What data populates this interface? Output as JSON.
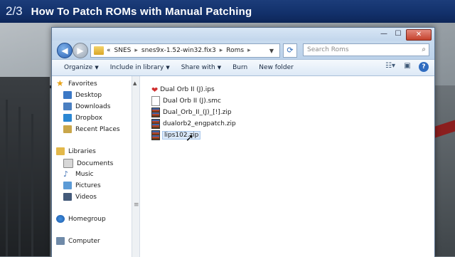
{
  "banner": {
    "step": "2/3",
    "title": "How To Patch ROMs with Manual Patching"
  },
  "window_controls": {
    "minimize": "—",
    "maximize": "☐",
    "close": "✕"
  },
  "address": {
    "root": "«",
    "crumbs": [
      "SNES",
      "snes9x-1.52-win32.fix3",
      "Roms"
    ],
    "separator": "▸",
    "search_placeholder": "Search Roms"
  },
  "toolbar": {
    "organize": "Organize",
    "include": "Include in library",
    "share": "Share with",
    "burn": "Burn",
    "new_folder": "New folder"
  },
  "nav": {
    "favorites": "Favorites",
    "desktop": "Desktop",
    "downloads": "Downloads",
    "dropbox": "Dropbox",
    "recent": "Recent Places",
    "libraries": "Libraries",
    "documents": "Documents",
    "music": "Music",
    "pictures": "Pictures",
    "videos": "Videos",
    "homegroup": "Homegroup",
    "computer": "Computer"
  },
  "files": [
    {
      "name": "Dual Orb II (J).ips",
      "icon": "heart-icon"
    },
    {
      "name": "Dual Orb II (J).smc",
      "icon": "document-icon"
    },
    {
      "name": "Dual_Orb_II_(J)_[!].zip",
      "icon": "zip-icon"
    },
    {
      "name": "dualorb2_engpatch.zip",
      "icon": "zip-icon"
    },
    {
      "name": "lips102.zip",
      "icon": "zip-icon"
    }
  ]
}
